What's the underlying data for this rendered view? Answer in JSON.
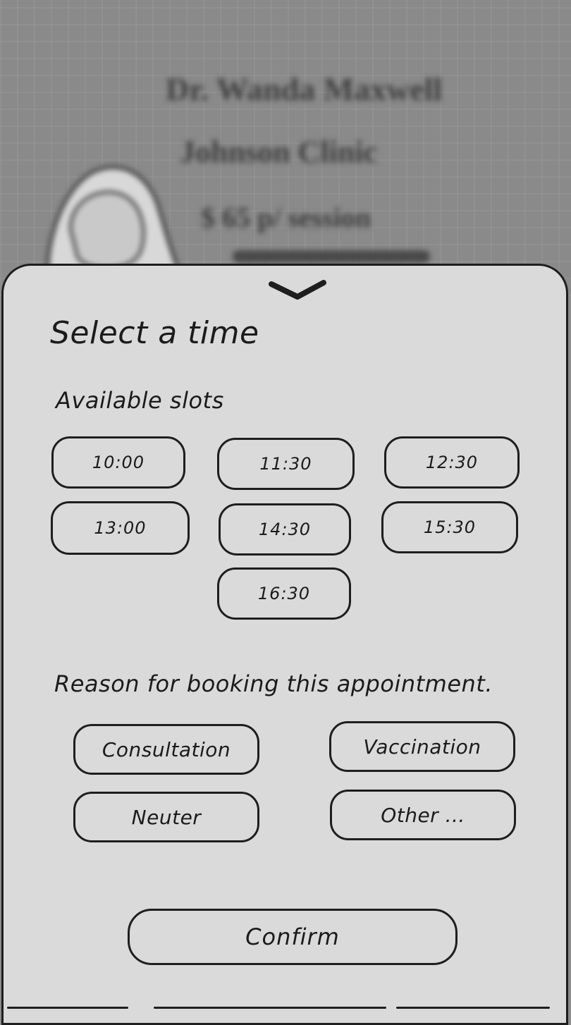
{
  "background_profile": {
    "doctor_name": "Dr. Wanda Maxwell",
    "clinic_name": "Johnson Clinic",
    "price_line": "$ 65 p/ session"
  },
  "sheet": {
    "collapse_icon": "chevron-down-icon",
    "title": "Select a time",
    "slots_label": "Available slots",
    "slots": [
      "10:00",
      "11:30",
      "12:30",
      "13:00",
      "14:30",
      "15:30",
      "16:30"
    ],
    "reason_label": "Reason for booking this appointment.",
    "reasons": [
      "Consultation",
      "Vaccination",
      "Neuter",
      "Other ..."
    ],
    "confirm_label": "Confirm"
  },
  "colors": {
    "sheet_background": "#dadada",
    "outline": "#1e1e1e",
    "backdrop": "#8a8a8a"
  }
}
